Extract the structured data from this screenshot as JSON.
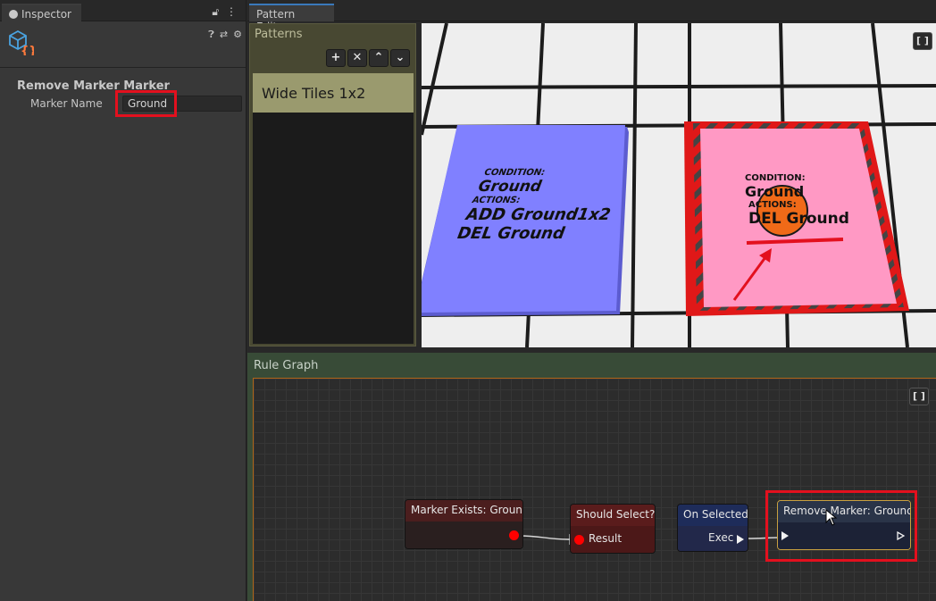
{
  "inspector": {
    "tab_label": "Inspector",
    "component_title": "Remove Marker Marker",
    "field_label": "Marker Name",
    "field_value": "Ground",
    "header_icons": [
      "help-icon",
      "presets-icon",
      "gear-icon"
    ]
  },
  "pattern_editor": {
    "tab_label": "Pattern Editor",
    "patterns_title": "Patterns",
    "buttons": [
      "+",
      "✕",
      "⌃",
      "⌄"
    ],
    "patterns": [
      "Wide Tiles 1x2"
    ],
    "viewport_button": "[ ]",
    "tiles": {
      "blue": {
        "condition_label": "CONDITION:",
        "condition_value": "Ground",
        "actions_label": "ACTIONS:",
        "action_1": "ADD Ground1x2",
        "action_2": "DEL Ground"
      },
      "pink": {
        "condition_label": "CONDITION:",
        "condition_value": "Ground",
        "actions_label": "ACTIONS:",
        "action_1": "DEL Ground"
      }
    }
  },
  "rule_graph": {
    "title": "Rule Graph",
    "frame_button": "[ ]",
    "nodes": {
      "marker_exists": {
        "title": "Marker Exists: Ground"
      },
      "should_select": {
        "title": "Should Select?",
        "port": "Result"
      },
      "on_selected": {
        "title": "On Selected",
        "port": "Exec"
      },
      "remove_marker": {
        "title": "Remove Marker: Ground"
      }
    }
  },
  "colors": {
    "highlight": "#e3101e",
    "pattern_selected": "#9a9a6e",
    "blue_tile": "#8080ff",
    "pink_tile": "#ff99c4"
  }
}
